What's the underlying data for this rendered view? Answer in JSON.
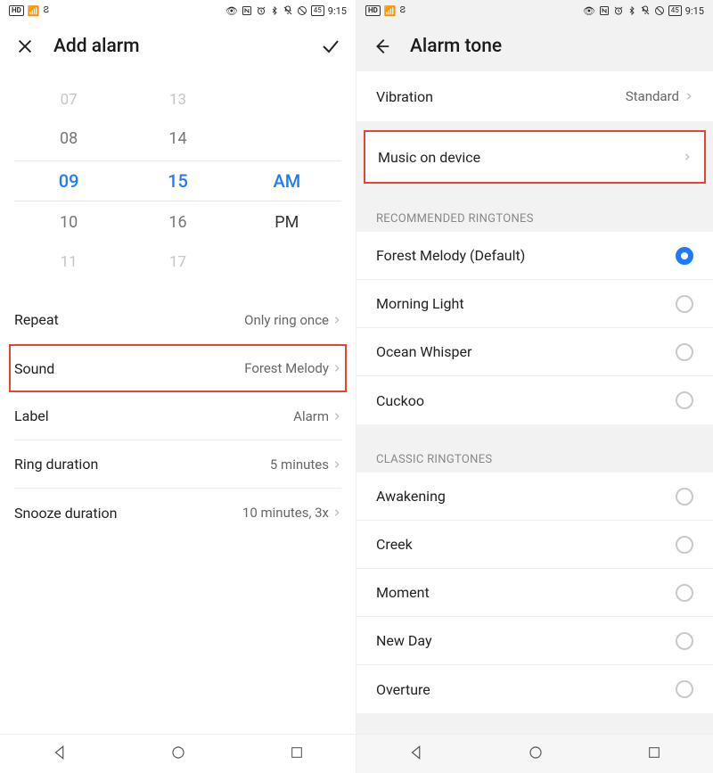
{
  "statusbar": {
    "hd": "HD",
    "battery": "45",
    "time": "9:15"
  },
  "left": {
    "title": "Add alarm",
    "picker": {
      "hours": [
        "07",
        "08",
        "09",
        "10",
        "11"
      ],
      "minutes": [
        "13",
        "14",
        "15",
        "16",
        "17"
      ],
      "am": "AM",
      "pm": "PM"
    },
    "settings": {
      "repeat": {
        "label": "Repeat",
        "value": "Only ring once"
      },
      "sound": {
        "label": "Sound",
        "value": "Forest Melody"
      },
      "alarm_label": {
        "label": "Label",
        "value": "Alarm"
      },
      "ring_duration": {
        "label": "Ring duration",
        "value": "5 minutes"
      },
      "snooze": {
        "label": "Snooze duration",
        "value": "10 minutes, 3x"
      }
    }
  },
  "right": {
    "title": "Alarm tone",
    "vibration": {
      "label": "Vibration",
      "value": "Standard"
    },
    "music_on_device": "Music on device",
    "sections": {
      "recommended": {
        "header": "RECOMMENDED RINGTONES",
        "items": [
          "Forest Melody (Default)",
          "Morning Light",
          "Ocean Whisper",
          "Cuckoo"
        ],
        "selected_index": 0
      },
      "classic": {
        "header": "CLASSIC RINGTONES",
        "items": [
          "Awakening",
          "Creek",
          "Moment",
          "New Day",
          "Overture"
        ]
      }
    }
  }
}
